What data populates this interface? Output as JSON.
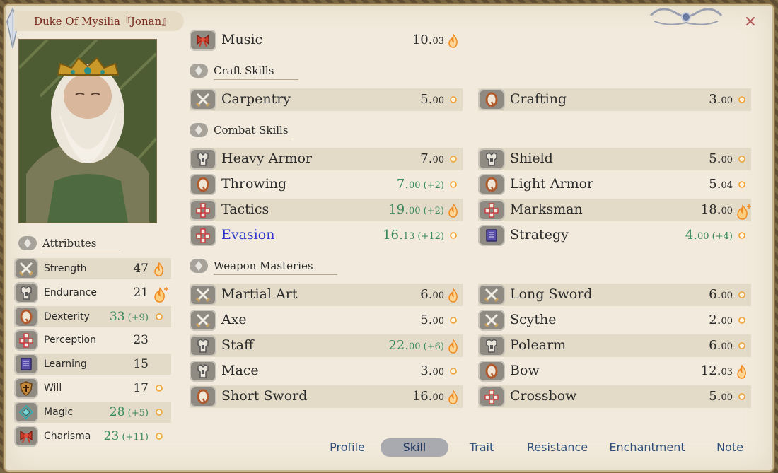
{
  "character": {
    "title": "Duke Of Mysilia『Jonan』"
  },
  "close_label": "×",
  "attributes": {
    "header": "Attributes",
    "items": [
      {
        "label": "Strength",
        "value": "47",
        "bonus": "",
        "icon": "crossed-swords-icon",
        "indicator": "flame"
      },
      {
        "label": "Endurance",
        "value": "21",
        "bonus": "",
        "icon": "armor-icon",
        "indicator": "flame-plus"
      },
      {
        "label": "Dexterity",
        "value": "33",
        "bonus": " (+9)",
        "icon": "shield-q-icon",
        "indicator": "dot"
      },
      {
        "label": "Perception",
        "value": "23",
        "bonus": "",
        "icon": "dice-icon",
        "indicator": "none"
      },
      {
        "label": "Learning",
        "value": "15",
        "bonus": "",
        "icon": "book-icon",
        "indicator": "none"
      },
      {
        "label": "Will",
        "value": "17",
        "bonus": "",
        "icon": "cross-shield-icon",
        "indicator": "dot"
      },
      {
        "label": "Magic",
        "value": "28",
        "bonus": " (+5)",
        "icon": "magic-rune-icon",
        "indicator": "dot"
      },
      {
        "label": "Charisma",
        "value": "23",
        "bonus": " (+11)",
        "icon": "ribbon-icon",
        "indicator": "dot"
      }
    ]
  },
  "skills": {
    "top": {
      "label": "Music",
      "value": "10.",
      "decimals": "03",
      "bonus": "",
      "icon": "ribbon-icon",
      "indicator": "flame"
    },
    "craft_header": "Craft Skills",
    "craft": [
      {
        "label": "Carpentry",
        "value": "5.",
        "decimals": "00",
        "bonus": "",
        "icon": "crossed-swords-icon",
        "indicator": "dot"
      },
      {
        "label": "Crafting",
        "value": "3.",
        "decimals": "00",
        "bonus": "",
        "icon": "shield-q-icon",
        "indicator": "dot"
      }
    ],
    "combat_header": "Combat Skills",
    "combat": [
      {
        "label": "Heavy Armor",
        "value": "7.",
        "decimals": "00",
        "bonus": "",
        "icon": "armor-icon",
        "indicator": "dot"
      },
      {
        "label": "Shield",
        "value": "5.",
        "decimals": "00",
        "bonus": "",
        "icon": "armor-icon",
        "indicator": "dot"
      },
      {
        "label": "Throwing",
        "value": "7.",
        "decimals": "00",
        "bonus": " (+2)",
        "icon": "shield-q-icon",
        "indicator": "dot"
      },
      {
        "label": "Light Armor",
        "value": "5.",
        "decimals": "04",
        "bonus": "",
        "icon": "shield-q-icon",
        "indicator": "dot"
      },
      {
        "label": "Tactics",
        "value": "19.",
        "decimals": "00",
        "bonus": " (+2)",
        "icon": "dice-icon",
        "indicator": "flame"
      },
      {
        "label": "Marksman",
        "value": "18.",
        "decimals": "00",
        "bonus": "",
        "icon": "dice-icon",
        "indicator": "flame-plus"
      },
      {
        "label": "Evasion",
        "value": "16.",
        "decimals": "13",
        "bonus": " (+12)",
        "icon": "dice-icon",
        "indicator": "dot"
      },
      {
        "label": "Strategy",
        "value": "4.",
        "decimals": "00",
        "bonus": " (+4)",
        "icon": "book-icon",
        "indicator": "dot"
      }
    ],
    "weapon_header": "Weapon Masteries",
    "weapon": [
      {
        "label": "Martial Art",
        "value": "6.",
        "decimals": "00",
        "bonus": "",
        "icon": "crossed-swords-icon",
        "indicator": "flame"
      },
      {
        "label": "Long Sword",
        "value": "6.",
        "decimals": "00",
        "bonus": "",
        "icon": "crossed-swords-icon",
        "indicator": "dot"
      },
      {
        "label": "Axe",
        "value": "5.",
        "decimals": "00",
        "bonus": "",
        "icon": "crossed-swords-icon",
        "indicator": "dot"
      },
      {
        "label": "Scythe",
        "value": "2.",
        "decimals": "00",
        "bonus": "",
        "icon": "crossed-swords-icon",
        "indicator": "dot"
      },
      {
        "label": "Staff",
        "value": "22.",
        "decimals": "00",
        "bonus": " (+6)",
        "icon": "armor-icon",
        "indicator": "flame"
      },
      {
        "label": "Polearm",
        "value": "6.",
        "decimals": "00",
        "bonus": "",
        "icon": "armor-icon",
        "indicator": "dot"
      },
      {
        "label": "Mace",
        "value": "3.",
        "decimals": "00",
        "bonus": "",
        "icon": "armor-icon",
        "indicator": "dot"
      },
      {
        "label": "Bow",
        "value": "12.",
        "decimals": "03",
        "bonus": "",
        "icon": "shield-q-icon",
        "indicator": "flame"
      },
      {
        "label": "Short Sword",
        "value": "16.",
        "decimals": "00",
        "bonus": "",
        "icon": "shield-q-icon",
        "indicator": "flame"
      },
      {
        "label": "Crossbow",
        "value": "5.",
        "decimals": "00",
        "bonus": "",
        "icon": "dice-icon",
        "indicator": "dot"
      }
    ]
  },
  "tabs": [
    {
      "label": "Profile",
      "active": false
    },
    {
      "label": "Skill",
      "active": true
    },
    {
      "label": "Trait",
      "active": false
    },
    {
      "label": "Resistance",
      "active": false
    },
    {
      "label": "Enchantment",
      "active": false
    },
    {
      "label": "Note",
      "active": false
    }
  ],
  "colors": {
    "bonus_green": "#3b8a5c",
    "highlight_blue": "#2b35c9",
    "title_red": "#7a2a1e",
    "flame_orange": "#f0a030"
  }
}
